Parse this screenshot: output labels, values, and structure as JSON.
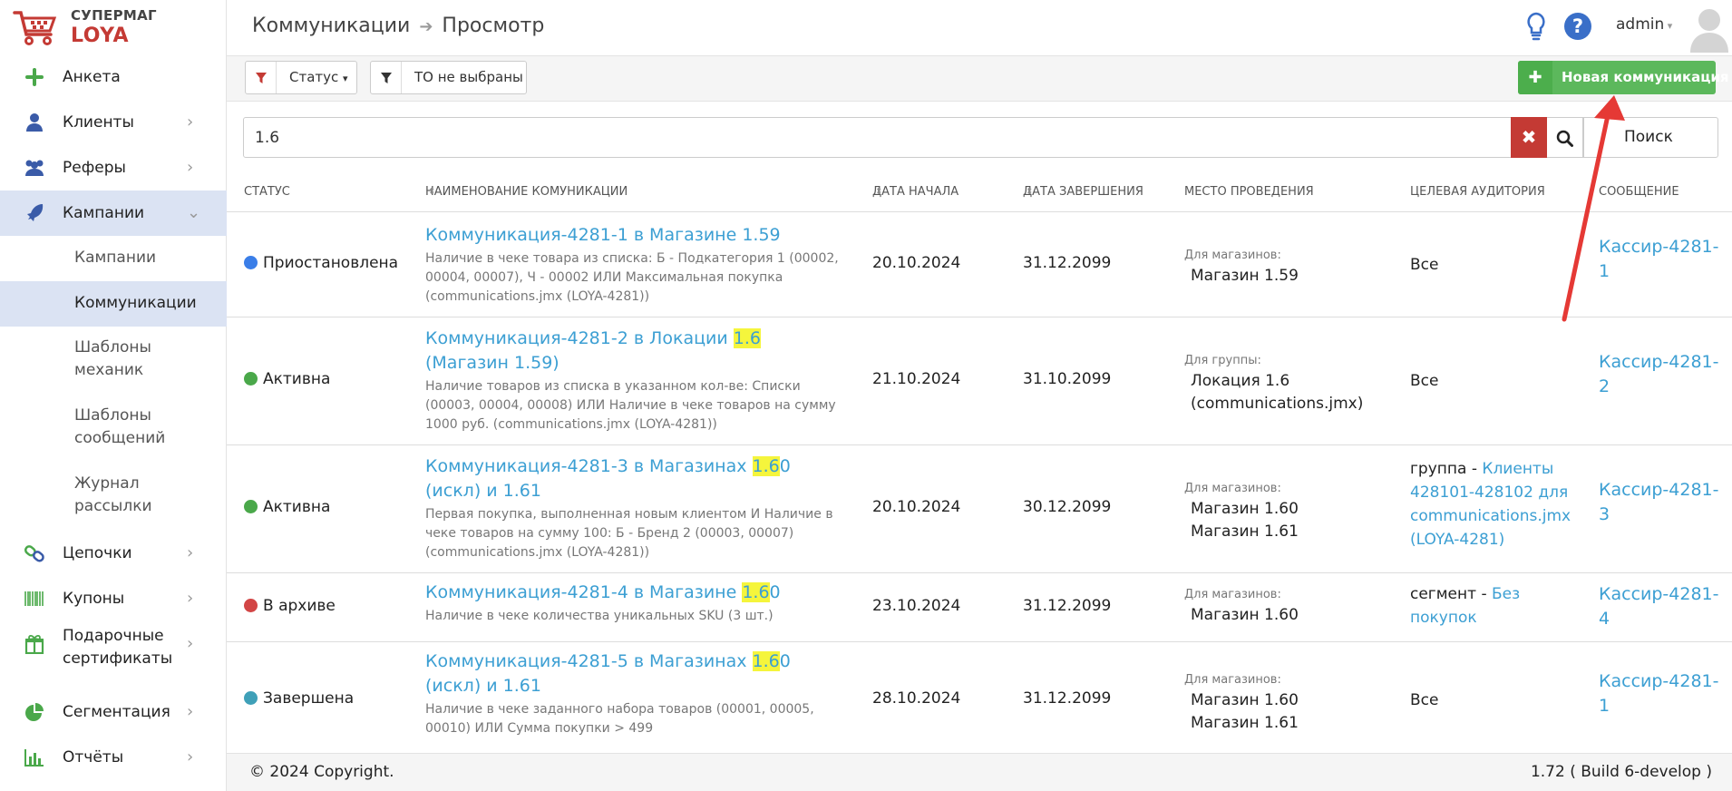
{
  "logo": {
    "line1": "СУПЕРМАГ",
    "line2": "LOYA"
  },
  "sidebar": {
    "items": [
      {
        "label": "Анкета",
        "icon": "plus-icon"
      },
      {
        "label": "Клиенты",
        "icon": "user-icon"
      },
      {
        "label": "Реферы",
        "icon": "users-icon"
      },
      {
        "label": "Кампании",
        "icon": "rocket-icon"
      },
      {
        "label": "Цепочки",
        "icon": "link-icon"
      },
      {
        "label": "Купоны",
        "icon": "barcode-icon"
      },
      {
        "label": "Подарочные сертификаты",
        "icon": "gift-icon"
      },
      {
        "label": "Сегментация",
        "icon": "pie-icon"
      },
      {
        "label": "Отчёты",
        "icon": "bar-chart-icon"
      }
    ],
    "sub_items": [
      "Кампании",
      "Коммуникации",
      "Шаблоны механик",
      "Шаблоны сообщений",
      "Журнал рассылки"
    ]
  },
  "header": {
    "crumb1": "Коммуникации",
    "crumb2": "Просмотр",
    "user": "admin"
  },
  "toolbar": {
    "status_filter": "Статус",
    "to_filter": "ТО не выбраны",
    "new_button": "Новая коммуникация"
  },
  "search": {
    "value": "1.6",
    "button": "Поиск"
  },
  "table": {
    "headers": {
      "status": "СТАТУС",
      "name": "НАИМЕНОВАНИЕ КОМУНИКАЦИИ",
      "start": "ДАТА НАЧАЛА",
      "end": "ДАТА ЗАВЕРШЕНИЯ",
      "place": "МЕСТО ПРОВЕДЕНИЯ",
      "audience": "ЦЕЛЕВАЯ АУДИТОРИЯ",
      "message": "СООБЩЕНИЕ"
    },
    "rows": [
      {
        "status": "Приостановлена",
        "status_color": "#3a7ee8",
        "name_pre": "Коммуникация-4281-1 в Магазине 1.59",
        "name_hl": "",
        "name_post": "",
        "desc": "Наличие в чеке товара из списка: Б - Подкатегория 1 (00002, 00004, 00007), Ч - 00002 ИЛИ Максимальная покупка (communications.jmx (LOYA-4281))",
        "start": "20.10.2024",
        "end": "31.12.2099",
        "place_label": "Для магазинов:",
        "place_values": [
          "Магазин 1.59"
        ],
        "aud_prefix": "",
        "aud_text": "Все",
        "aud_link": "",
        "message": "Кассир-4281-1"
      },
      {
        "status": "Активна",
        "status_color": "#4aa84a",
        "name_pre": "Коммуникация-4281-2 в Локации ",
        "name_hl": "1.6",
        "name_post": " (Магазин 1.59)",
        "desc": "Наличие товаров из списка в указанном кол-ве: Списки (00003, 00004, 00008) ИЛИ Наличие в чеке товаров на сумму 1000 руб. (communications.jmx (LOYA-4281))",
        "start": "21.10.2024",
        "end": "31.10.2099",
        "place_label": "Для группы:",
        "place_values": [
          "Локация 1.6 (communications.jmx)"
        ],
        "aud_prefix": "",
        "aud_text": "Все",
        "aud_link": "",
        "message": "Кассир-4281-2"
      },
      {
        "status": "Активна",
        "status_color": "#4aa84a",
        "name_pre": "Коммуникация-4281-3 в Магазинах ",
        "name_hl": "1.6",
        "name_post": "0 (искл) и 1.61",
        "desc": "Первая покупка, выполненная новым клиентом И Наличие в чеке товаров на сумму 100: Б - Бренд 2 (00003, 00007) (communications.jmx (LOYA-4281))",
        "start": "20.10.2024",
        "end": "30.12.2099",
        "place_label": "Для магазинов:",
        "place_values": [
          "Магазин 1.60",
          "Магазин 1.61"
        ],
        "aud_prefix": "группа - ",
        "aud_text": "",
        "aud_link": "Клиенты 428101-428102 для communications.jmx (LOYA-4281)",
        "message": "Кассир-4281-3"
      },
      {
        "status": "В архиве",
        "status_color": "#d24545",
        "name_pre": "Коммуникация-4281-4 в Магазине ",
        "name_hl": "1.6",
        "name_post": "0",
        "desc": "Наличие в чеке количества уникальных SKU (3 шт.)",
        "start": "23.10.2024",
        "end": "31.12.2099",
        "place_label": "Для магазинов:",
        "place_values": [
          "Магазин 1.60"
        ],
        "aud_prefix": "сегмент - ",
        "aud_text": "",
        "aud_link": "Без покупок",
        "message": "Кассир-4281-4"
      },
      {
        "status": "Завершена",
        "status_color": "#3fa0b8",
        "name_pre": "Коммуникация-4281-5 в Магазинах ",
        "name_hl": "1.6",
        "name_post": "0 (искл) и 1.61",
        "desc": "Наличие в чеке заданного набора товаров (00001, 00005, 00010) ИЛИ Сумма покупки > 499",
        "start": "28.10.2024",
        "end": "31.12.2099",
        "place_label": "Для магазинов:",
        "place_values": [
          "Магазин 1.60",
          "Магазин 1.61"
        ],
        "aud_prefix": "",
        "aud_text": "Все",
        "aud_link": "",
        "message": "Кассир-4281-1"
      }
    ]
  },
  "footer": {
    "copyright": "© 2024 Copyright.",
    "version": "1.72 ( Build 6-develop )"
  },
  "colors": {
    "accent": "#3c9fd3",
    "brand": "#c43a34",
    "success": "#5cb85c",
    "highlight": "#f5f53c"
  }
}
